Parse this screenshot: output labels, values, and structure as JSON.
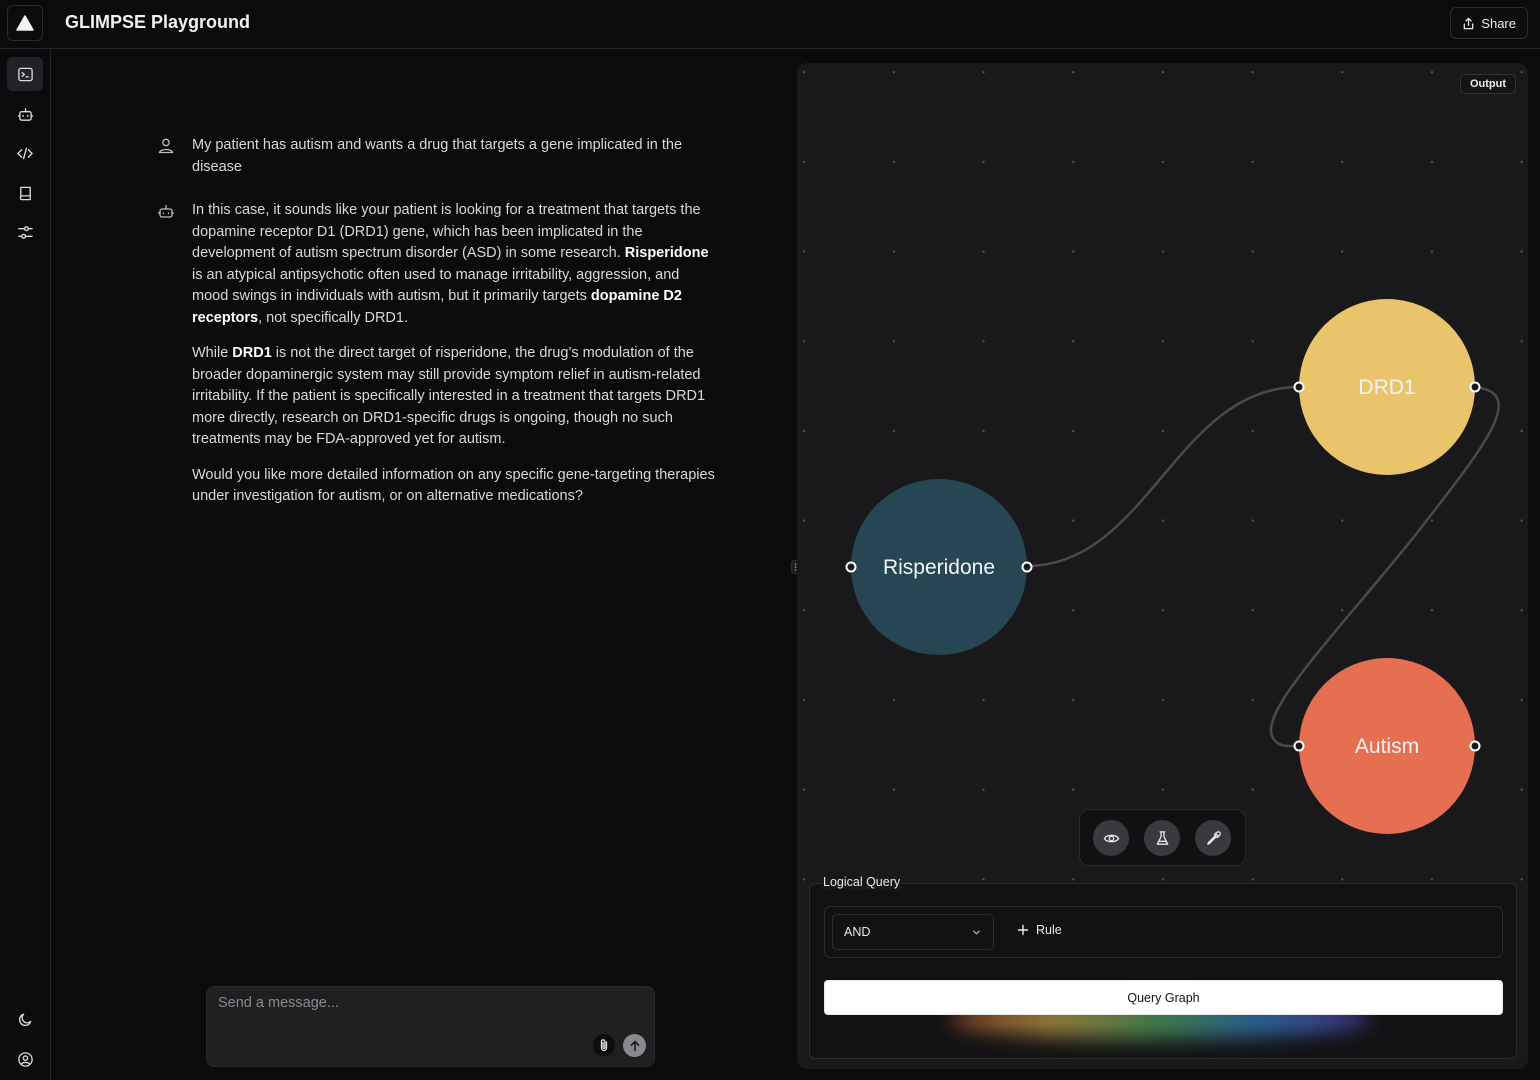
{
  "header": {
    "title": "GLIMPSE Playground",
    "share_label": "Share"
  },
  "sidebar": {
    "items": [
      {
        "name": "terminal",
        "active": true
      },
      {
        "name": "bot",
        "active": false
      },
      {
        "name": "code",
        "active": false
      },
      {
        "name": "book",
        "active": false
      },
      {
        "name": "settings-sliders",
        "active": false
      }
    ],
    "bottom": [
      "theme-moon",
      "account"
    ]
  },
  "chat": {
    "user_message": "My patient has autism and wants a drug that targets a gene implicated in the disease",
    "assistant": {
      "p1_a": "In this case, it sounds like your patient is looking for a treatment that targets the dopamine receptor D1 (DRD1) gene, which has been implicated in the development of autism spectrum disorder (ASD) in some research. ",
      "p1_b": "Risperidone",
      "p1_c": " is an atypical antipsychotic often used to manage irritability, aggression, and mood swings in individuals with autism, but it primarily targets ",
      "p1_d": "dopamine D2 receptors",
      "p1_e": ", not specifically DRD1.",
      "p2_a": "While ",
      "p2_b": "DRD1",
      "p2_c": " is not the direct target of risperidone, the drug’s modulation of the broader dopaminergic system may still provide symptom relief in autism-related irritability. If the patient is specifically interested in a treatment that targets DRD1 more directly, research on DRD1-specific drugs is ongoing, though no such treatments may be FDA-approved yet for autism.",
      "p3": "Would you like more detailed information on any specific gene-targeting therapies under investigation for autism, or on alternative medications?"
    },
    "composer_placeholder": "Send a message..."
  },
  "graph": {
    "output_label": "Output",
    "nodes": [
      {
        "id": "risperidone",
        "label": "Risperidone",
        "color": "#264653"
      },
      {
        "id": "drd1",
        "label": "DRD1",
        "color": "#e9c46a"
      },
      {
        "id": "autism",
        "label": "Autism",
        "color": "#e76f51"
      }
    ],
    "edges": [
      {
        "from": "Risperidone",
        "to": "DRD1"
      },
      {
        "from": "DRD1",
        "to": "Autism"
      }
    ],
    "tools": [
      "eye-icon",
      "flask-icon",
      "pipette-icon"
    ]
  },
  "logical_query": {
    "legend": "Logical Query",
    "operator": "AND",
    "add_rule_label": "Rule",
    "submit_label": "Query Graph"
  }
}
